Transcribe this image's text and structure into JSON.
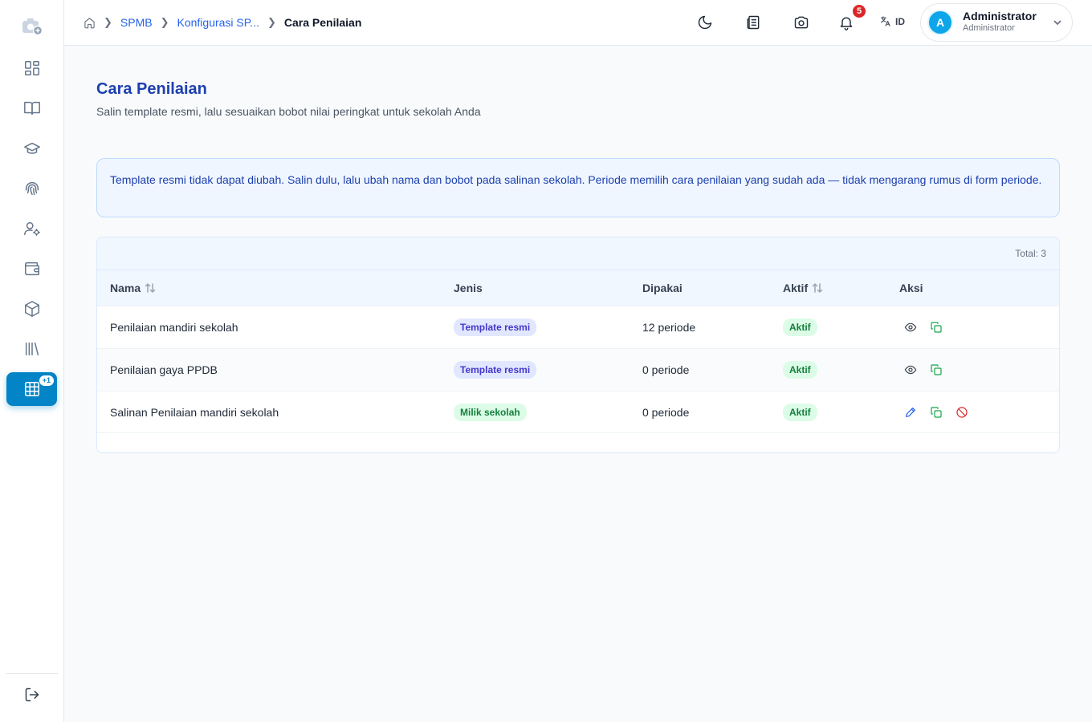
{
  "breadcrumb": {
    "items": [
      "SPMB",
      "Konfigurasi SP...",
      "Cara Penilaian"
    ]
  },
  "header": {
    "notifications_count": "5",
    "language": "ID",
    "user_initial": "A",
    "user_name": "Administrator",
    "user_role": "Administrator"
  },
  "sidebar": {
    "active_badge": "+1",
    "icons": [
      "camera-plus-icon",
      "dashboard-icon",
      "book-icon",
      "graduation-cap-icon",
      "fingerprint-icon",
      "user-settings-icon",
      "wallet-icon",
      "package-icon",
      "library-icon",
      "table-grid-icon",
      "logout-icon"
    ]
  },
  "page": {
    "title": "Cara Penilaian",
    "subtitle": "Salin template resmi, lalu sesuaikan bobot nilai peringkat untuk sekolah Anda",
    "info": "Template resmi tidak dapat diubah. Salin dulu, lalu ubah nama dan bobot pada salinan sekolah. Periode memilih cara penilaian yang sudah ada — tidak mengarang rumus di form periode."
  },
  "table": {
    "total": "Total: 3",
    "headers": {
      "nama": "Nama",
      "jenis": "Jenis",
      "dipakai": "Dipakai",
      "aktif": "Aktif",
      "aksi": "Aksi"
    },
    "rows": [
      {
        "nama": "Penilaian mandiri sekolah",
        "jenis": "Template resmi",
        "dipakai": "12 periode",
        "aktif": "Aktif"
      },
      {
        "nama": "Penilaian gaya PPDB",
        "jenis": "Template resmi",
        "dipakai": "0 periode",
        "aktif": "Aktif"
      },
      {
        "nama": "Salinan Penilaian mandiri sekolah",
        "jenis": "Milik sekolah",
        "dipakai": "0 periode",
        "aktif": "Aktif"
      }
    ]
  }
}
